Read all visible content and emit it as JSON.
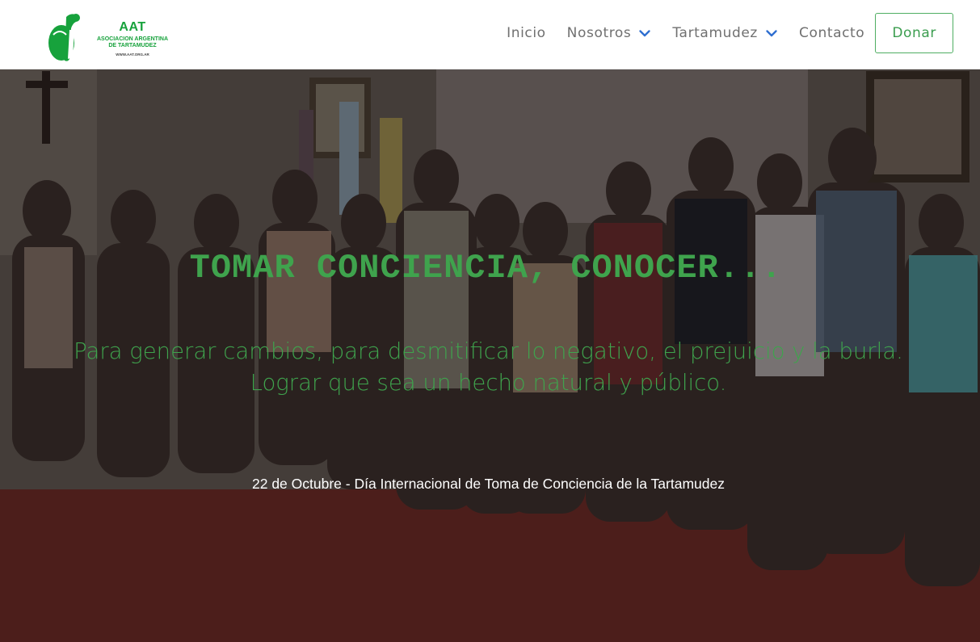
{
  "brand": {
    "title": "AAT",
    "subtitle_line1": "ASOCIACION ARGENTINA",
    "subtitle_line2": "DE TARTAMUDEZ",
    "url": "WWW.AAT.ORG.AR",
    "color": "#17a23c"
  },
  "nav": {
    "items": [
      {
        "label": "Inicio",
        "has_dropdown": false
      },
      {
        "label": "Nosotros",
        "has_dropdown": true,
        "icon": "chevron-down-icon"
      },
      {
        "label": "Tartamudez",
        "has_dropdown": true,
        "icon": "chevron-down-icon"
      },
      {
        "label": "Contacto",
        "has_dropdown": false
      }
    ],
    "donate_label": "Donar",
    "accent": "#3b9d4f",
    "chevron_color": "#2f6fd0"
  },
  "hero": {
    "title": "TOMAR CONCIENCIA, CONOCER...",
    "subtitle_line1": "Para generar cambios, para desmitificar lo negativo, el prejuicio y la burla.",
    "subtitle_line2": "Lograr que sea un hecho natural y público.",
    "date_line": "22 de Octubre - Día Internacional de Toma de Conciencia de la Tartamudez",
    "text_color": "#3fa34d",
    "image": "group-photo"
  }
}
